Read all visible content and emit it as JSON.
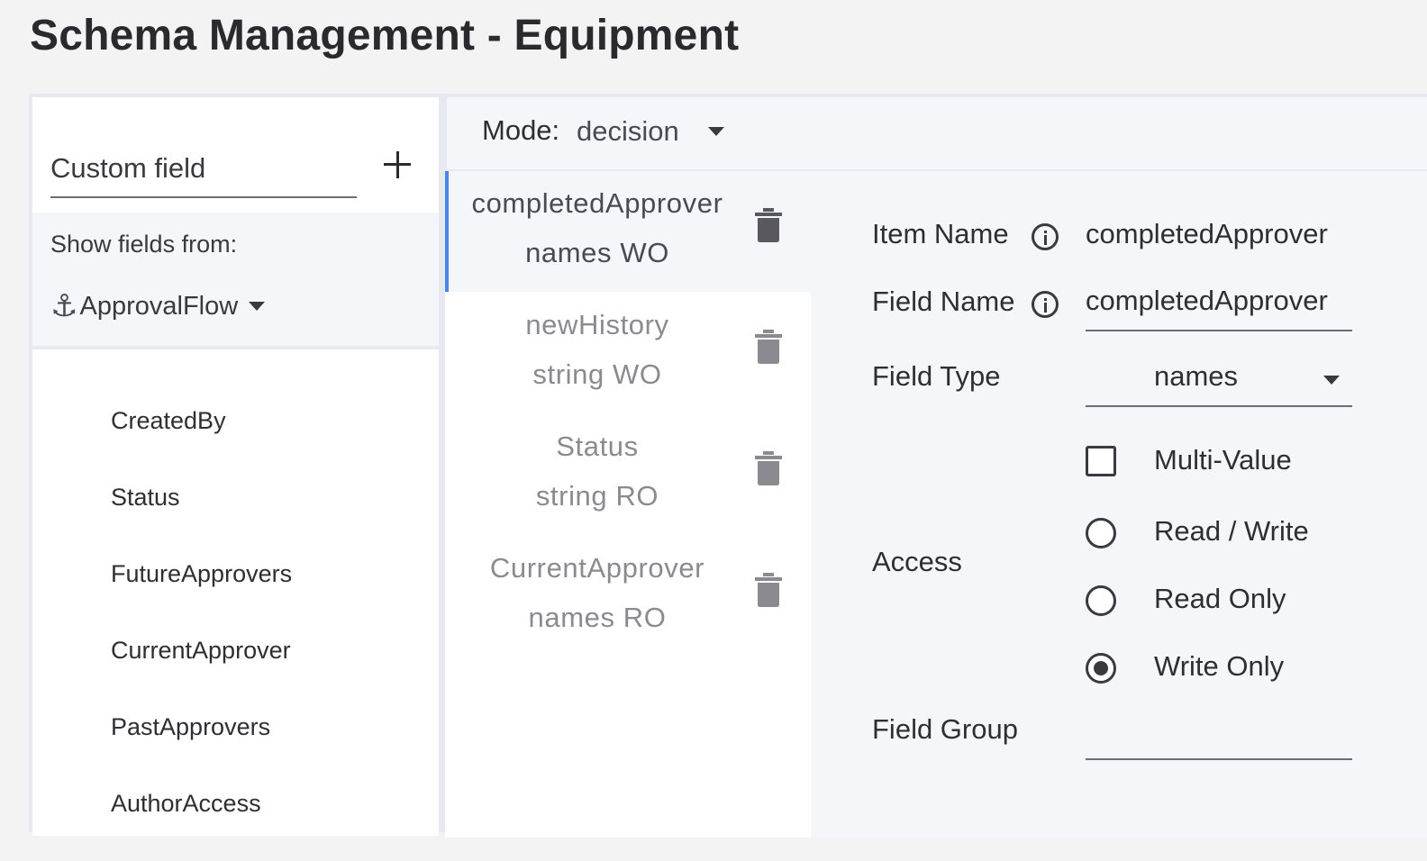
{
  "page": {
    "title": "Schema Management - Equipment"
  },
  "left": {
    "custom_field_placeholder": "Custom field",
    "add_icon": "plus-icon",
    "show_fields_label": "Show fields from:",
    "source_icon": "anchor-icon",
    "source_value": "ApprovalFlow",
    "fields": [
      "CreatedBy",
      "Status",
      "FutureApprovers",
      "CurrentApprover",
      "PastApprovers",
      "AuthorAccess"
    ]
  },
  "mode": {
    "label": "Mode:",
    "value": "decision"
  },
  "schema_items": [
    {
      "name": "completedApprover",
      "meta": "names WO",
      "selected": true
    },
    {
      "name": "newHistory",
      "meta": "string WO",
      "selected": false
    },
    {
      "name": "Status",
      "meta": "string RO",
      "selected": false
    },
    {
      "name": "CurrentApprover",
      "meta": "names RO",
      "selected": false
    }
  ],
  "detail": {
    "item_name_label": "Item Name",
    "item_name_value": "completedApprover",
    "field_name_label": "Field Name",
    "field_name_value": "completedApprover",
    "field_type_label": "Field Type",
    "field_type_value": "names",
    "multi_value_label": "Multi-Value",
    "multi_value_checked": false,
    "access_label": "Access",
    "access_options": [
      "Read / Write",
      "Read Only",
      "Write Only"
    ],
    "access_selected": "Write Only",
    "field_group_label": "Field Group",
    "field_group_value": ""
  },
  "colors": {
    "accent": "#4a86e8",
    "panel_bg": "#f5f6fa",
    "page_bg": "#f3f3f4"
  }
}
